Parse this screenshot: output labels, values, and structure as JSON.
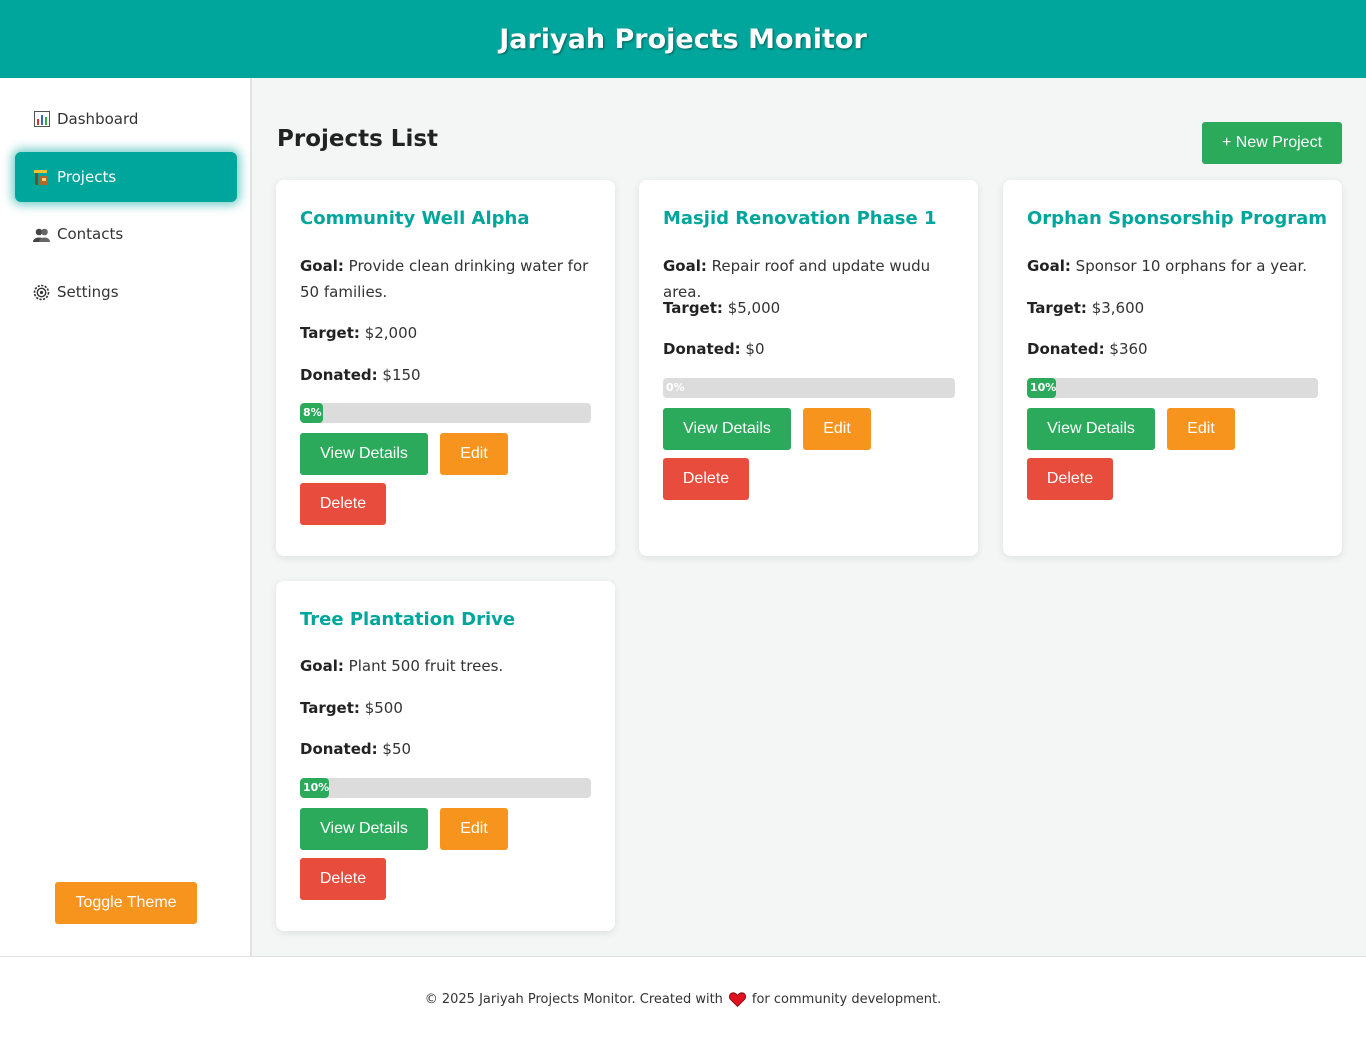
{
  "header": {
    "title": "Jariyah Projects Monitor"
  },
  "sidebar": {
    "items": [
      {
        "label": "Dashboard",
        "icon": "chart-icon"
      },
      {
        "label": "Projects",
        "icon": "construction-icon",
        "active": true
      },
      {
        "label": "Contacts",
        "icon": "people-icon"
      },
      {
        "label": "Settings",
        "icon": "gear-icon"
      }
    ],
    "toggle_label": "Toggle Theme"
  },
  "main": {
    "title": "Projects List",
    "new_project_label": "+ New Project",
    "labels": {
      "goal": "Goal:",
      "target": "Target:",
      "donated": "Donated:"
    },
    "buttons": {
      "view": "View Details",
      "edit": "Edit",
      "delete": "Delete"
    },
    "projects": [
      {
        "name": "Community Well Alpha",
        "goal": "Provide clean drinking water for 50 families.",
        "target": "$2,000",
        "donated": "$150",
        "progress": 8,
        "progress_label": "8%"
      },
      {
        "name": "Masjid Renovation Phase 1",
        "goal": "Repair roof and update wudu area.",
        "target": "$5,000",
        "donated": "$0",
        "progress": 0,
        "progress_label": "0%"
      },
      {
        "name": "Orphan Sponsorship Program",
        "goal": "Sponsor 10 orphans for a year.",
        "target": "$3,600",
        "donated": "$360",
        "progress": 10,
        "progress_label": "10%"
      },
      {
        "name": "Tree Plantation Drive",
        "goal": "Plant 500 fruit trees.",
        "target": "$500",
        "donated": "$50",
        "progress": 10,
        "progress_label": "10%"
      }
    ]
  },
  "footer": {
    "text_before": "© 2025 Jariyah Projects Monitor. Created with",
    "text_after": "for community development."
  },
  "colors": {
    "primary": "#00a69c",
    "success": "#2aaa5a",
    "warning": "#f7941d",
    "danger": "#e74c3c"
  }
}
